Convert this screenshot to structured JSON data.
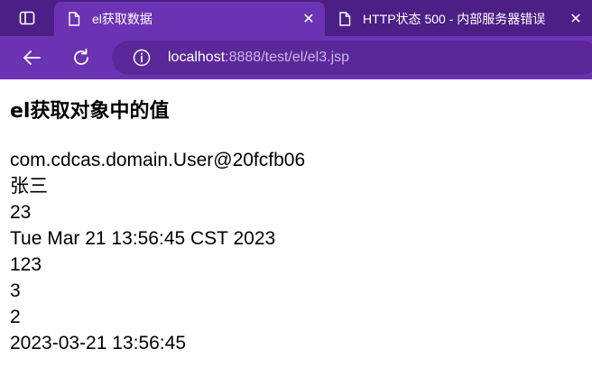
{
  "browser": {
    "tabs": [
      {
        "title": "el获取数据",
        "active": true,
        "close_label": "✕"
      },
      {
        "title": "HTTP状态 500 - 内部服务器错误",
        "active": false,
        "close_label": "✕"
      }
    ],
    "address": {
      "host": "localhost",
      "rest": ":8888/test/el/el3.jsp"
    },
    "colors": {
      "tabstrip": "#4b1f86",
      "toolbar": "#6b32b4",
      "omnibox": "#5a2899"
    }
  },
  "page": {
    "heading": "el获取对象中的值",
    "lines": [
      "com.cdcas.domain.User@20fcfb06",
      "张三",
      "23",
      "Tue Mar 21 13:56:45 CST 2023",
      "123",
      "3",
      "2",
      "2023-03-21 13:56:45"
    ]
  }
}
